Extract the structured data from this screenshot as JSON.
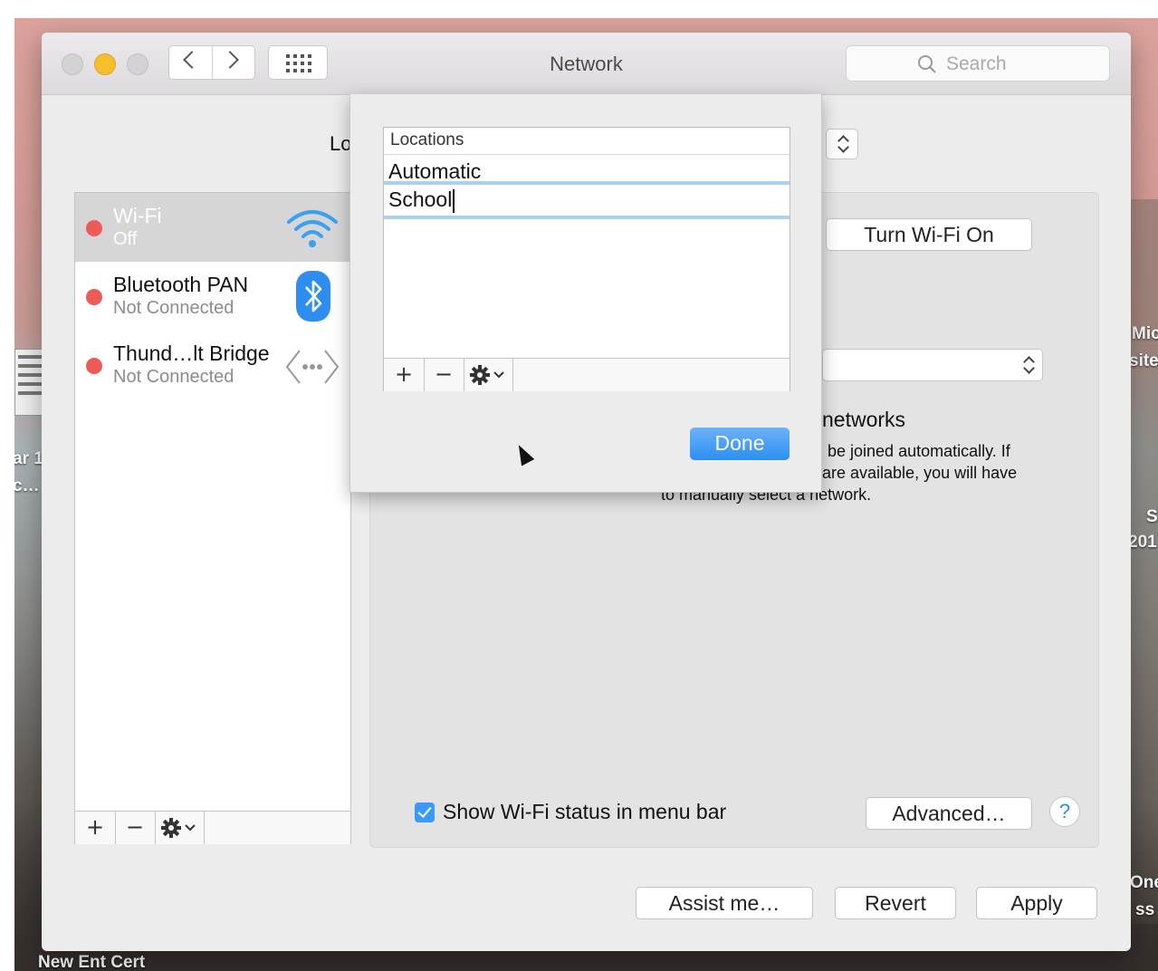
{
  "window": {
    "title": "Network"
  },
  "search": {
    "placeholder": "Search"
  },
  "location": {
    "label": "Lo"
  },
  "services": [
    {
      "name": "Wi-Fi",
      "status": "Off",
      "icon": "wifi-icon",
      "selected": true
    },
    {
      "name": "Bluetooth PAN",
      "status": "Not Connected",
      "icon": "bluetooth-icon",
      "selected": false
    },
    {
      "name": "Thund…lt Bridge",
      "status": "Not Connected",
      "icon": "thunderbolt-bridge-icon",
      "selected": false
    }
  ],
  "detail": {
    "turn_wifi_label": "Turn Wi-Fi On",
    "known_networks_heading": "networks",
    "known_networks_text_1": "be joined automatically. If",
    "known_networks_text_2": "are available, you will have",
    "known_networks_text_3": "to manually select a network.",
    "show_status_label": "Show Wi-Fi status in menu bar",
    "show_status_checked": true,
    "advanced_label": "Advanced…",
    "help_label": "?"
  },
  "locations_sheet": {
    "header": "Locations",
    "items": [
      "Automatic",
      "School"
    ],
    "editing_index": 1,
    "done_label": "Done"
  },
  "list_tools": {
    "add": "+",
    "remove": "−"
  },
  "bottom": {
    "assist_label": "Assist me…",
    "revert_label": "Revert",
    "apply_label": "Apply"
  },
  "desktop": {
    "labels": [
      "Mic",
      "site",
      "ar 1",
      "c…",
      "S",
      "201",
      "One",
      "ss",
      "New Ent Cert"
    ]
  },
  "colors": {
    "accent": "#3b99fc",
    "status_off": "#ee5b57",
    "done_button": "#2d8ef0"
  }
}
